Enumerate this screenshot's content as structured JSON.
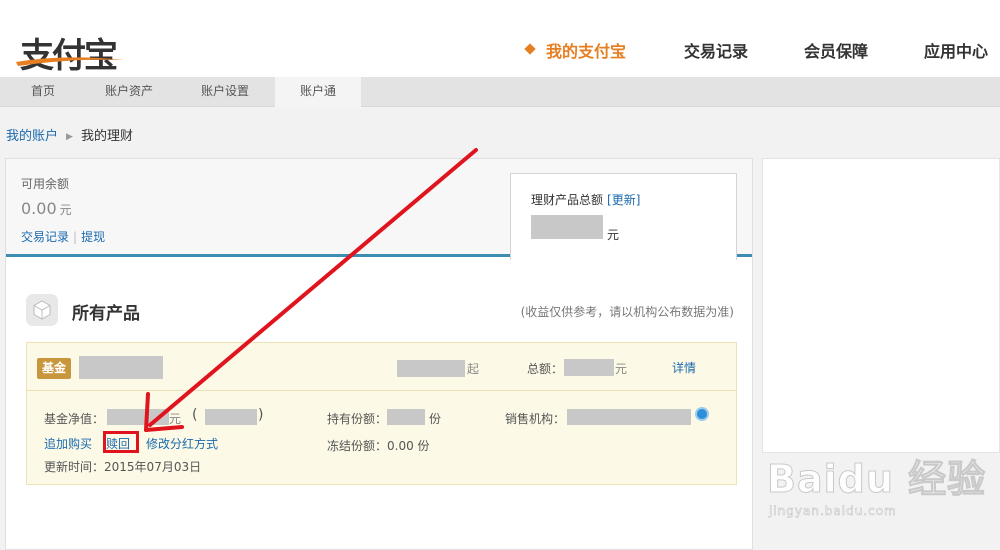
{
  "header": {
    "logo_text": "支付宝",
    "nav": [
      {
        "label": "我的支付宝",
        "active": true
      },
      {
        "label": "交易记录",
        "active": false
      },
      {
        "label": "会员保障",
        "active": false
      },
      {
        "label": "应用中心",
        "active": false
      }
    ]
  },
  "subnav": [
    {
      "label": "首页",
      "active": false
    },
    {
      "label": "账户资产",
      "active": false
    },
    {
      "label": "账户设置",
      "active": false
    },
    {
      "label": "账户通",
      "active": true
    }
  ],
  "breadcrumb": {
    "parent": "我的账户",
    "separator": "▶",
    "current": "我的理财"
  },
  "balance": {
    "label": "可用余额",
    "value": "0.00",
    "unit": "元",
    "links": [
      "交易记录",
      "提现"
    ],
    "separator": "|"
  },
  "total_box": {
    "label": "理财产品总额",
    "refresh_label": "[更新]",
    "unit": "元"
  },
  "products": {
    "title": "所有产品",
    "note": "(收益仅供参考，请以机构公布数据为准)"
  },
  "fund": {
    "tag": "基金",
    "qi_suffix": "起",
    "total_label": "总额：",
    "total_unit": "元",
    "detail_link": "详情",
    "nav_label": "基金净值：",
    "nav_unit": "元",
    "paren_open": "(",
    "paren_close": ")",
    "holding_label": "持有份额：",
    "holding_unit": "份",
    "agent_label": "销售机构：",
    "frozen_label": "冻结份额：",
    "frozen_value": "0.00 份",
    "actions": [
      "追加购买",
      "赎回",
      "修改分红方式"
    ],
    "update_label": "更新时间：",
    "update_value": "2015年07月03日"
  },
  "watermark": {
    "logo": "Baidu 经验",
    "url": "jingyan.baidu.com"
  },
  "colors": {
    "accent_orange": "#e67e22",
    "link_blue": "#1a6aaf",
    "highlight_red": "#e0141e",
    "fund_tag": "#c8963c",
    "card_bg": "#fcf9e6"
  }
}
